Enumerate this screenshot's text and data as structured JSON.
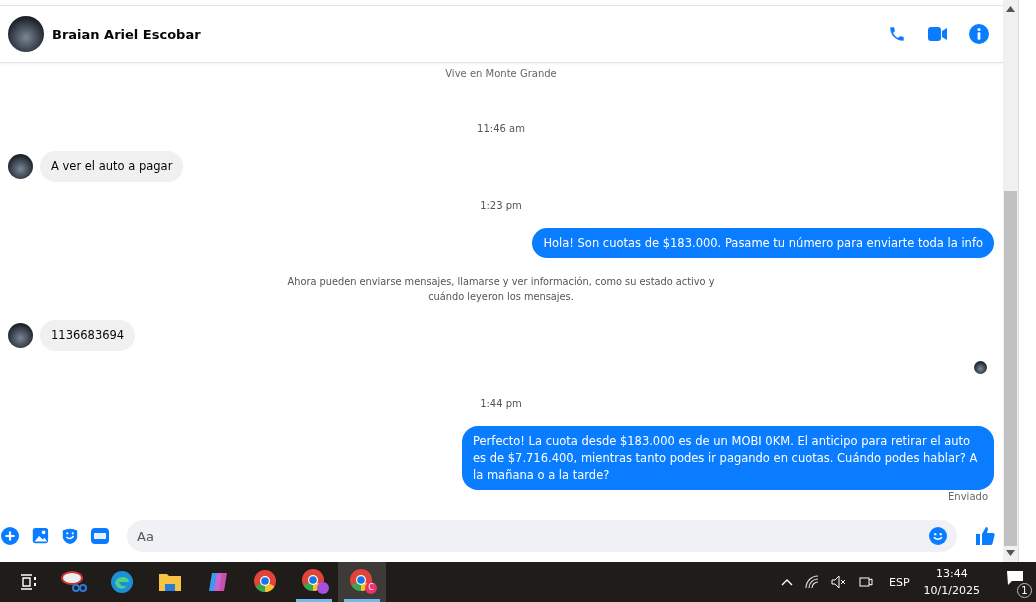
{
  "header": {
    "name": "Braian Ariel Escobar"
  },
  "messages": [
    {
      "kind": "info",
      "text": "Vive en Monte Grande"
    },
    {
      "kind": "time",
      "text": "11:46 am"
    },
    {
      "kind": "incoming",
      "text": "A ver el auto a pagar"
    },
    {
      "kind": "time",
      "text": "1:23 pm"
    },
    {
      "kind": "outgoing",
      "text": "Hola! Son cuotas de $183.000. Pasame tu número para enviarte toda la info"
    },
    {
      "kind": "notice",
      "text": "Ahora pueden enviarse mensajes, llamarse y ver información, como su estado activo y cuándo leyeron los mensajes."
    },
    {
      "kind": "incoming",
      "text": "1136683694"
    },
    {
      "kind": "seen"
    },
    {
      "kind": "time",
      "text": "1:44 pm"
    },
    {
      "kind": "outgoing",
      "text": "Perfecto! La cuota desde $183.000 es de un MOBI 0KM. El anticipo para retirar el auto es de $7.716.400, mientras tanto podes ir pagando en cuotas. Cuándo podes hablar? A la mañana o a la tarde?"
    },
    {
      "kind": "status",
      "text": "Enviado"
    }
  ],
  "composer": {
    "placeholder": "Aa"
  },
  "taskbar": {
    "apps": [
      {
        "kind": "snip",
        "selected": false,
        "running": false
      },
      {
        "kind": "edge",
        "selected": false,
        "running": false
      },
      {
        "kind": "folder",
        "selected": false,
        "running": false
      },
      {
        "kind": "copilot",
        "selected": false,
        "running": false
      },
      {
        "kind": "chrome",
        "selected": false,
        "running": false
      },
      {
        "kind": "chrome",
        "color": "#a64ee0",
        "selected": false,
        "running": true
      },
      {
        "kind": "chrome",
        "badge": "C",
        "color": "#e8336b",
        "selected": true,
        "running": true
      }
    ],
    "language": "ESP",
    "time": "13:44",
    "date": "10/1/2025",
    "notifications": "1"
  }
}
